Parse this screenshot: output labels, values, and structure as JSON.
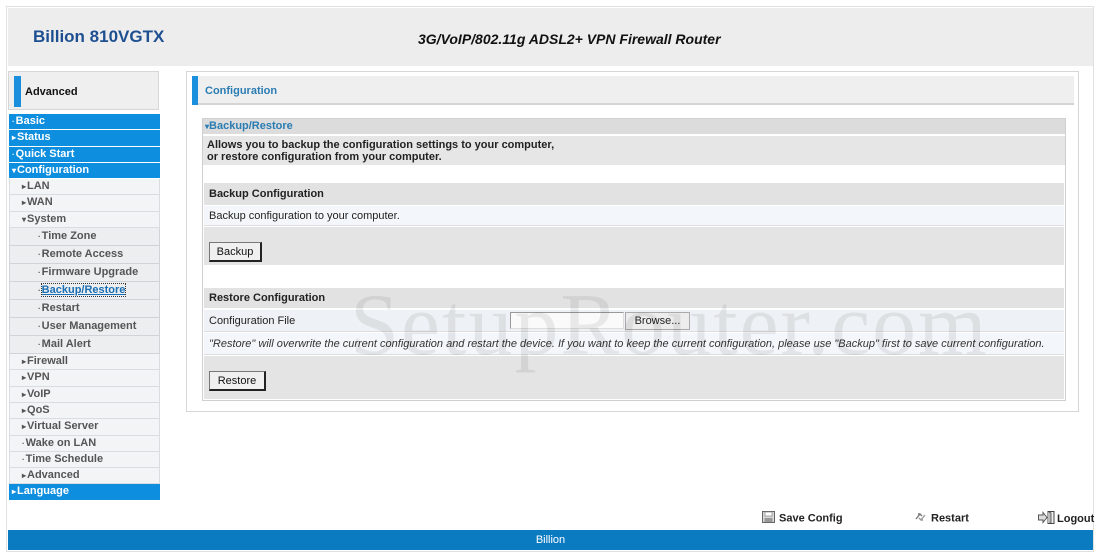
{
  "header": {
    "brand": "Billion 810VGTX",
    "tagline": "3G/VoIP/802.11g ADSL2+ VPN Firewall Router"
  },
  "sidebar": {
    "mode_label": "Advanced",
    "items": [
      {
        "label": "Basic",
        "level": "top",
        "arrow": "·"
      },
      {
        "label": "Status",
        "level": "top",
        "arrow": "▸"
      },
      {
        "label": "Quick Start",
        "level": "top",
        "arrow": "·"
      },
      {
        "label": "Configuration",
        "level": "top",
        "arrow": "▾"
      },
      {
        "label": "LAN",
        "level": "sub",
        "arrow": "▸"
      },
      {
        "label": "WAN",
        "level": "sub",
        "arrow": "▸"
      },
      {
        "label": "System",
        "level": "sub",
        "arrow": "▾"
      },
      {
        "label": "Time Zone",
        "level": "subsub",
        "arrow": "·"
      },
      {
        "label": "Remote Access",
        "level": "subsub",
        "arrow": "·"
      },
      {
        "label": "Firmware Upgrade",
        "level": "subsub",
        "arrow": "·"
      },
      {
        "label": "Backup/Restore",
        "level": "subsub",
        "arrow": "·",
        "active": true
      },
      {
        "label": "Restart",
        "level": "subsub",
        "arrow": "·"
      },
      {
        "label": "User Management",
        "level": "subsub",
        "arrow": "·"
      },
      {
        "label": "Mail Alert",
        "level": "subsub",
        "arrow": "·"
      },
      {
        "label": "Firewall",
        "level": "sub",
        "arrow": "▸"
      },
      {
        "label": "VPN",
        "level": "sub",
        "arrow": "▸"
      },
      {
        "label": "VoIP",
        "level": "sub",
        "arrow": "▸"
      },
      {
        "label": "QoS",
        "level": "sub",
        "arrow": "▸"
      },
      {
        "label": "Virtual Server",
        "level": "sub",
        "arrow": "▸"
      },
      {
        "label": "Wake on LAN",
        "level": "sub",
        "arrow": "·"
      },
      {
        "label": "Time Schedule",
        "level": "sub",
        "arrow": "·"
      },
      {
        "label": "Advanced",
        "level": "sub",
        "arrow": "▸"
      },
      {
        "label": "Language",
        "level": "top",
        "arrow": "▸"
      }
    ]
  },
  "main": {
    "title": "Configuration",
    "section_title": "Backup/Restore",
    "description_line1": "Allows you to backup the configuration settings to your computer,",
    "description_line2": "or restore configuration from your computer.",
    "backup": {
      "heading": "Backup Configuration",
      "text": "Backup configuration to your computer.",
      "button": "Backup"
    },
    "restore": {
      "heading": "Restore Configuration",
      "file_label": "Configuration File",
      "file_value": "",
      "browse_button": "Browse...",
      "note": "\"Restore\" will overwrite the current configuration and restart the device. If you want to keep the current configuration, please use \"Backup\" first to save current configuration.",
      "button": "Restore"
    }
  },
  "watermark": "SetupRouter.com",
  "bottom_bar": {
    "save_config": "Save Config",
    "restart": "Restart",
    "logout": "Logout"
  },
  "footer": {
    "text": "Billion"
  }
}
